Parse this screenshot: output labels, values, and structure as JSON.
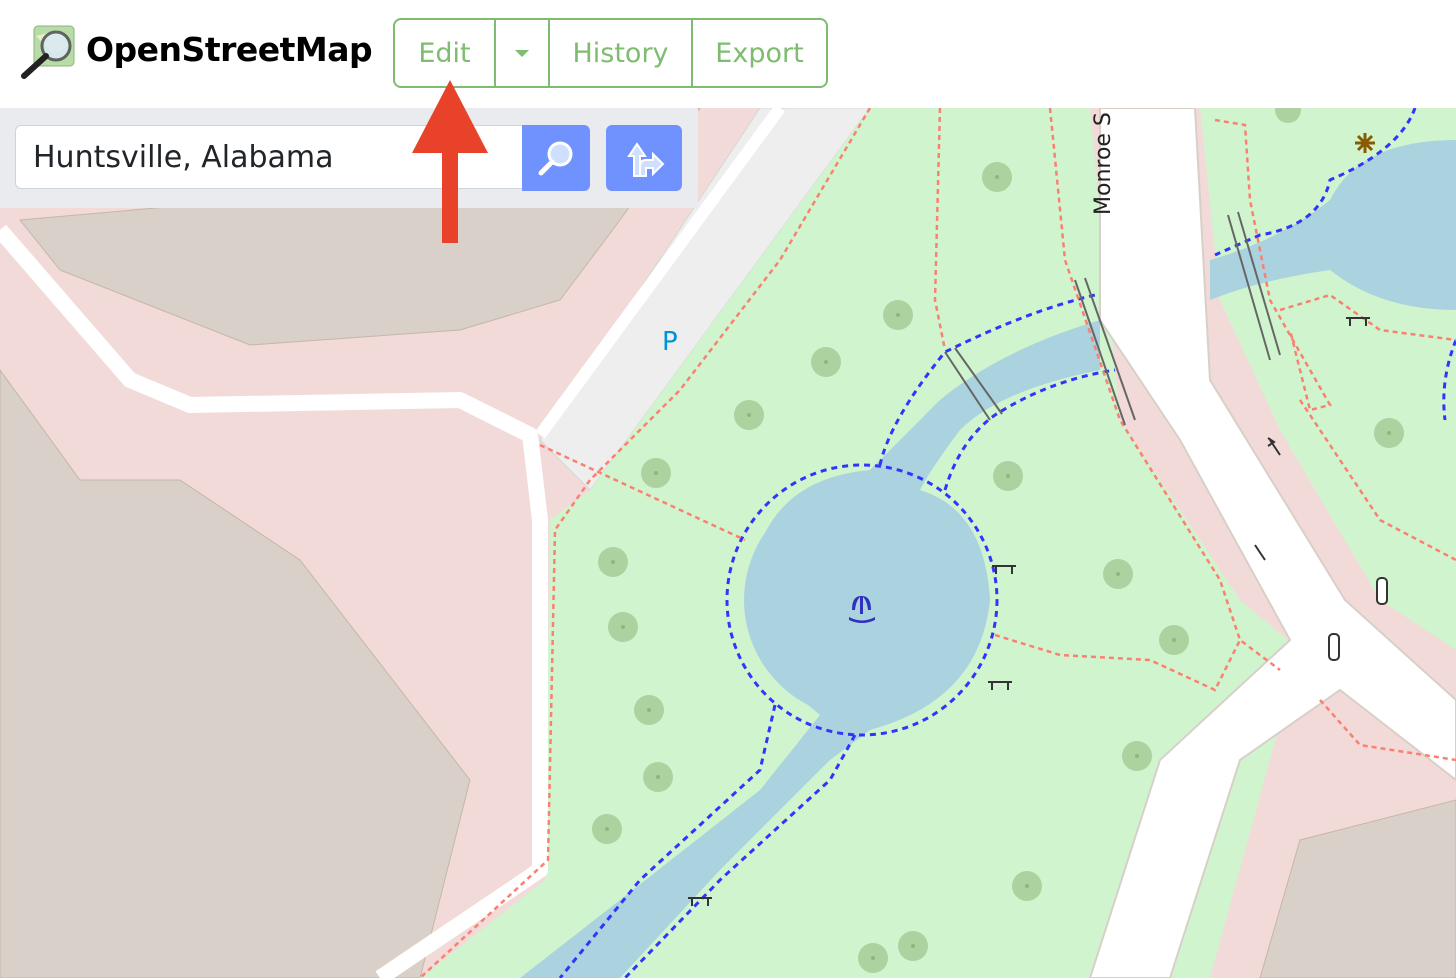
{
  "header": {
    "brand": "OpenStreetMap",
    "logo_icon": "osm-magnifier-logo-icon",
    "nav": {
      "edit": "Edit",
      "history": "History",
      "export": "Export",
      "dropdown_icon": "caret-down-icon"
    },
    "accent_color": "#7ebc6f"
  },
  "search": {
    "value": "Huntsville, Alabama",
    "search_icon": "magnifier-icon",
    "directions_icon": "directions-arrow-icon",
    "button_color": "#7092ff"
  },
  "map": {
    "labels": {
      "street": "Monroe S",
      "parking": "P"
    },
    "colors": {
      "park": "#d0f5ce",
      "water": "#aad3df",
      "commercial": "#f2dad9",
      "building": "#d9d0c9",
      "path_dashed": "#fa8072",
      "water_path": "#3333ff"
    }
  },
  "annotation": {
    "arrow_color": "#e8432a",
    "points_to": "Edit"
  }
}
